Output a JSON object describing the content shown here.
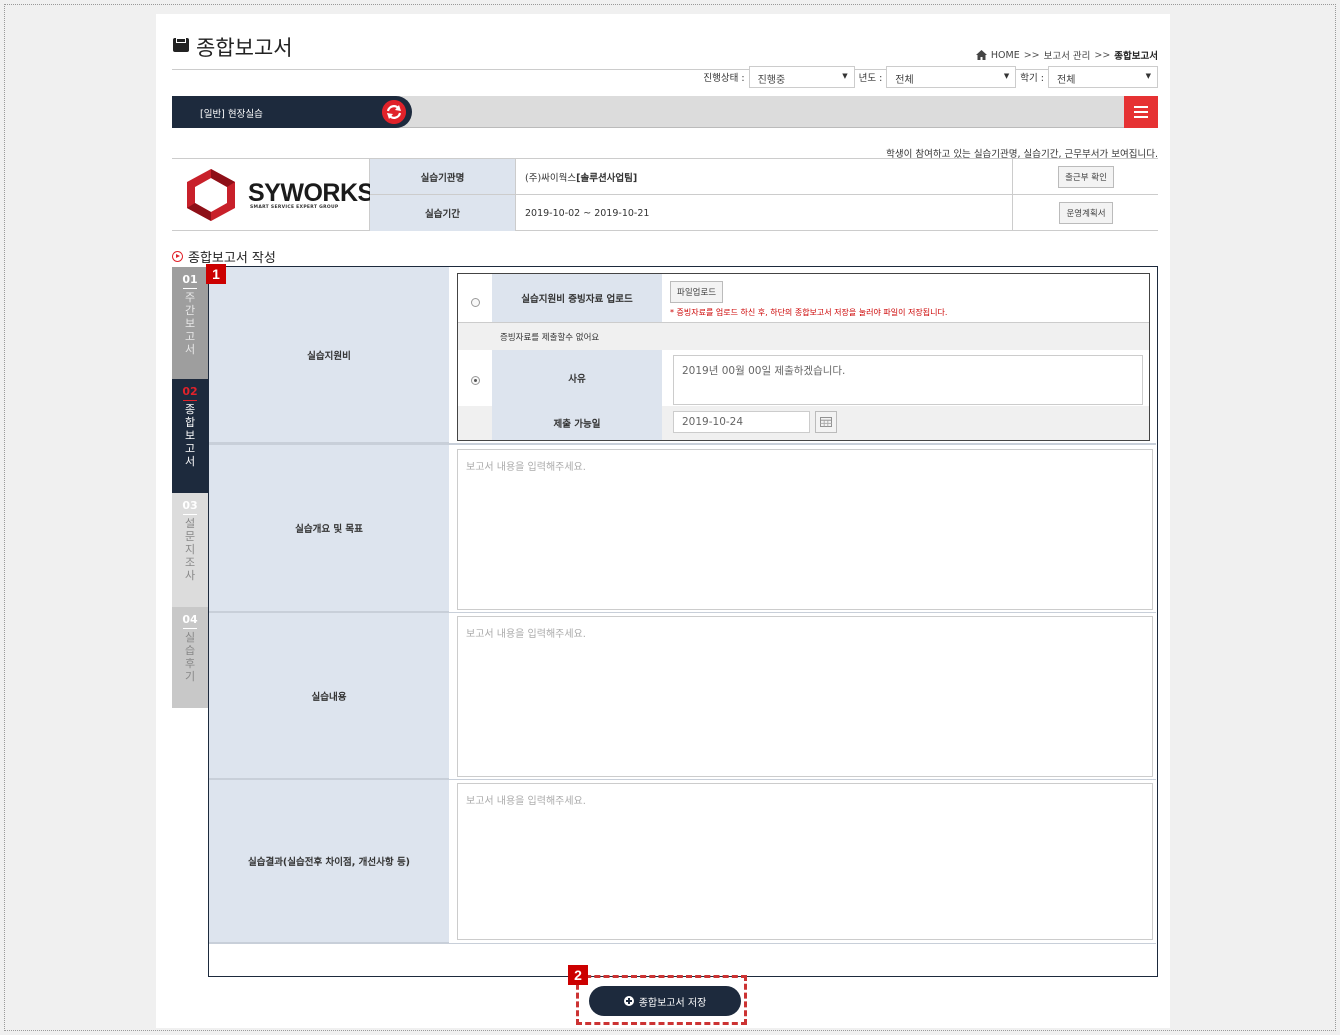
{
  "header": {
    "title": "종합보고서",
    "breadcrumb": [
      "HOME",
      "보고서 관리",
      "종합보고서"
    ],
    "breadcrumb_sep": ">>"
  },
  "filters": [
    {
      "label": "진행상태 :",
      "value": "진행중"
    },
    {
      "label": "년도 :",
      "value": "전체"
    },
    {
      "label": "학기 :",
      "value": "전체"
    }
  ],
  "main_bar": {
    "label": "[일반] 현장실습"
  },
  "notice": "학생이 참여하고 있는 실습기관명, 실습기간, 근무부서가 보여집니다.",
  "company": {
    "logo_text": "SYWORKS",
    "logo_sub": "SMART SERVICE EXPERT GROUP",
    "rows": [
      {
        "label": "실습기관명",
        "value": "(주)싸이웍스",
        "value_bold": "[솔루션사업팀]",
        "button": "출근부 확인"
      },
      {
        "label": "실습기간",
        "value": "2019-10-02 ~ 2019-10-21",
        "value_bold": "",
        "button": "운영계획서"
      }
    ]
  },
  "section_title": "종합보고서 작성",
  "side_tabs": [
    {
      "num": "01",
      "text": [
        "주",
        "간",
        "보",
        "고",
        "서"
      ]
    },
    {
      "num": "02",
      "text": [
        "종",
        "합",
        "보",
        "고",
        "서"
      ]
    },
    {
      "num": "03",
      "text": [
        "설",
        "문",
        "지",
        "조",
        "사"
      ]
    },
    {
      "num": "04",
      "text": [
        "실",
        "습",
        "후",
        "기"
      ]
    }
  ],
  "form": {
    "support_label": "실습지원비",
    "upload_label": "실습지원비 증빙자료 업로드",
    "upload_button": "파일업로드",
    "upload_note": "* 증빙자료를 업로드 하신 후, 하단의 종합보고서 저장을 눌러야 파일이 저장됩니다.",
    "no_docs_text": "증빙자료를 제출할수 없어요",
    "reason_label": "사유",
    "reason_value": "2019년 00월 00일 제출하겠습니다.",
    "date_label": "제출 가능일",
    "date_value": "2019-10-24",
    "rows": [
      {
        "label": "실습개요 및 목표",
        "placeholder": "보고서 내용을 입력해주세요."
      },
      {
        "label": "실습내용",
        "placeholder": "보고서 내용을 입력해주세요."
      },
      {
        "label": "실습결과(실습전후 차이점, 개선사항 등)",
        "placeholder": "보고서 내용을 입력해주세요."
      }
    ]
  },
  "save_button": "종합보고서 저장",
  "markers": [
    "1",
    "2"
  ],
  "colors": {
    "navy": "#1d2a3d",
    "red": "#e0222a",
    "label_bg": "#dde4ee",
    "note_red": "#cc0000"
  }
}
